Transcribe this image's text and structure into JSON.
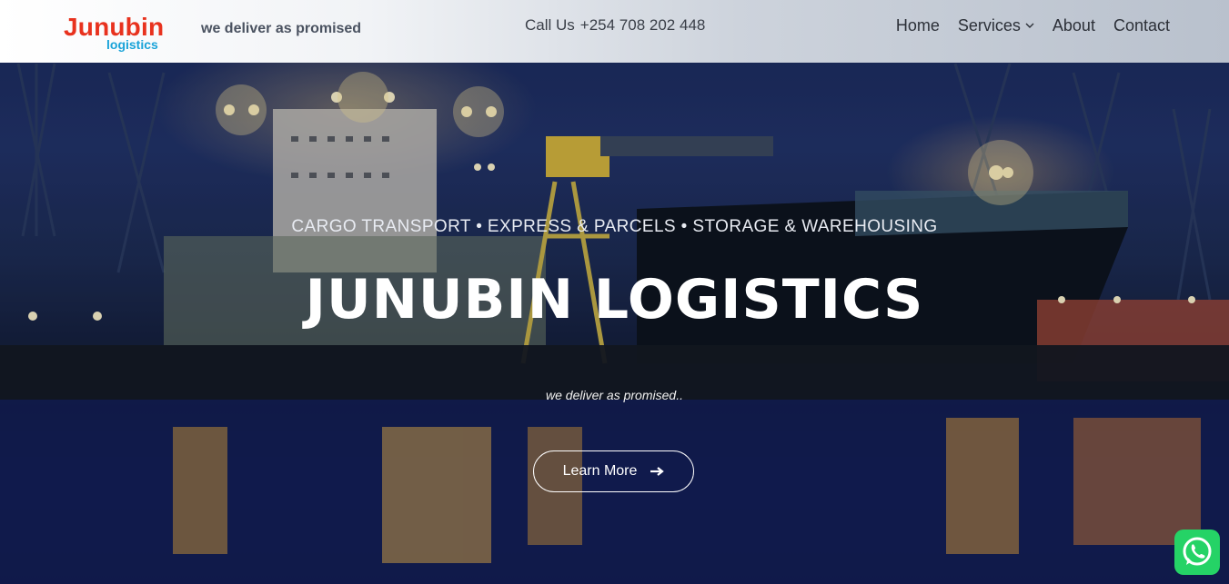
{
  "header": {
    "logo_main": "Junubin",
    "logo_sub": "logistics",
    "tagline": "we deliver as promised",
    "call_label": "Call Us",
    "phone": "+254 708 202 448",
    "nav": [
      {
        "label": "Home"
      },
      {
        "label": "Services",
        "has_dropdown": true
      },
      {
        "label": "About"
      },
      {
        "label": "Contact"
      }
    ]
  },
  "hero": {
    "services_line": "CARGO TRANSPORT • EXPRESS & PARCELS • STORAGE & WAREHOUSING",
    "title": "JUNUBIN LOGISTICS",
    "tagline": "we deliver as promised..",
    "cta_label": "Learn More",
    "cta_icon": "arrow-right-icon",
    "background_scene": "night harbor with ships and cranes"
  },
  "floating": {
    "whatsapp_icon": "whatsapp-icon"
  },
  "colors": {
    "logo_red": "#e8321e",
    "logo_blue": "#1aa3d8",
    "whatsapp_green": "#25d366"
  }
}
